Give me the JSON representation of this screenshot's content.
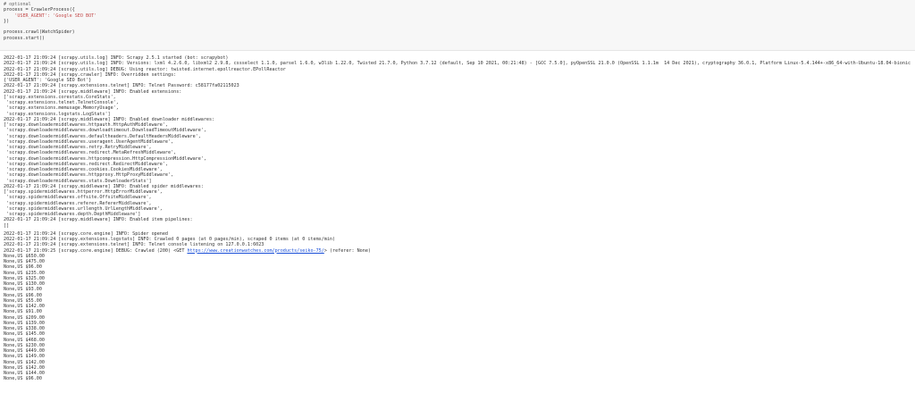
{
  "code_cell": {
    "lines": [
      "# optional",
      "process = CrawlerProcess({",
      "    'USER_AGENT': 'Google SEO BOT'",
      "})",
      "",
      "process.crawl(WatchSpider)",
      "process.start()"
    ]
  },
  "log": {
    "section1": [
      "2022-01-17 21:09:24 [scrapy.utils.log] INFO: Scrapy 2.5.1 started (bot: scrapybot)",
      "2022-01-17 21:09:24 [scrapy.utils.log] INFO: Versions: lxml 4.2.6.0, libxml2 2.9.8, cssselect 1.1.0, parsel 1.6.0, w3lib 1.22.0, Twisted 21.7.0, Python 3.7.12 (default, Sep 10 2021, 00:21:48) - [GCC 7.5.0], pyOpenSSL 21.0.0 (OpenSSL 1.1.1m  14 Dec 2021), cryptography 36.0.1, Platform Linux-5.4.144+-x86_64-with-Ubuntu-18.04-bionic",
      "2022-01-17 21:09:24 [scrapy.utils.log] DEBUG: Using reactor: twisted.internet.epollreactor.EPollReactor",
      "2022-01-17 21:09:24 [scrapy.crawler] INFO: Overridden settings:",
      "{'USER_AGENT': 'Google SEO Bot'}",
      "2022-01-17 21:09:24 [scrapy.extensions.telnet] INFO: Telnet Password: c58177fa02115023",
      "2022-01-17 21:09:24 [scrapy.middleware] INFO: Enabled extensions:",
      "['scrapy.extensions.corestats.CoreStats',",
      " 'scrapy.extensions.telnet.TelnetConsole',",
      " 'scrapy.extensions.memusage.MemoryUsage',",
      " 'scrapy.extensions.logstats.LogStats']",
      "2022-01-17 21:09:24 [scrapy.middleware] INFO: Enabled downloader middlewares:",
      "['scrapy.downloadermiddlewares.httpauth.HttpAuthMiddleware',",
      " 'scrapy.downloadermiddlewares.downloadtimeout.DownloadTimeoutMiddleware',",
      " 'scrapy.downloadermiddlewares.defaultheaders.DefaultHeadersMiddleware',",
      " 'scrapy.downloadermiddlewares.useragent.UserAgentMiddleware',",
      " 'scrapy.downloadermiddlewares.retry.RetryMiddleware',",
      " 'scrapy.downloadermiddlewares.redirect.MetaRefreshMiddleware',",
      " 'scrapy.downloadermiddlewares.httpcompression.HttpCompressionMiddleware',",
      " 'scrapy.downloadermiddlewares.redirect.RedirectMiddleware',",
      " 'scrapy.downloadermiddlewares.cookies.CookiesMiddleware',",
      " 'scrapy.downloadermiddlewares.httpproxy.HttpProxyMiddleware',",
      " 'scrapy.downloadermiddlewares.stats.DownloaderStats']",
      "2022-01-17 21:09:24 [scrapy.middleware] INFO: Enabled spider middlewares:",
      "['scrapy.spidermiddlewares.httperror.HttpErrorMiddleware',",
      " 'scrapy.spidermiddlewares.offsite.OffsiteMiddleware',",
      " 'scrapy.spidermiddlewares.referer.RefererMiddleware',",
      " 'scrapy.spidermiddlewares.urllength.UrlLengthMiddleware',",
      " 'scrapy.spidermiddlewares.depth.DepthMiddleware']",
      "2022-01-17 21:09:24 [scrapy.middleware] INFO: Enabled item pipelines:",
      "[]"
    ],
    "section2": [
      "2022-01-17 21:09:24 [scrapy.core.engine] INFO: Spider opened",
      "2022-01-17 21:09:24 [scrapy.extensions.logstats] INFO: Crawled 0 pages (at 0 pages/min), scraped 0 items (at 0 items/min)",
      "2022-01-17 21:09:24 [scrapy.extensions.telnet] INFO: Telnet console listening on 127.0.0.1:6023"
    ],
    "crawled_prefix": "2022-01-17 21:09:25 [scrapy.core.engine] DEBUG: Crawled (200) <GET ",
    "crawled_url": "https://www.creationwatches.com/products/seiko-75/",
    "crawled_suffix": "> (referer: None)"
  },
  "prices": [
    "None,US $650.00",
    "None,US $475.00",
    "None,US $96.00",
    "None,US $235.00",
    "None,US $325.00",
    "None,US $130.00",
    "None,US $93.00",
    "None,US $96.00",
    "None,US $55.00",
    "None,US $142.00",
    "None,US $91.00",
    "None,US $209.00",
    "None,US $139.00",
    "None,US $338.00",
    "None,US $145.00",
    "None,US $468.00",
    "None,US $230.00",
    "None,US $449.00",
    "None,US $149.00",
    "None,US $142.00",
    "None,US $142.00",
    "None,US $144.00",
    "None,US $96.00"
  ]
}
